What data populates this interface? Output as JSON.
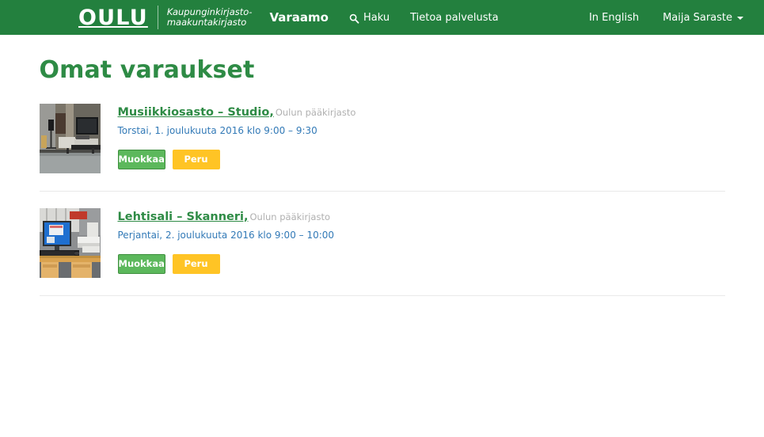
{
  "header": {
    "logo_text": "OULU",
    "logo_subtitle_line1": "Kaupunginkirjasto-",
    "logo_subtitle_line2": "maakuntakirjasto",
    "brand_link": "Varaamo",
    "search_label": "Haku",
    "about_label": "Tietoa palvelusta",
    "language_label": "In English",
    "user_name": "Maija Saraste",
    "background_color": "#23803E"
  },
  "main": {
    "page_title": "Omat varaukset",
    "reservations": [
      {
        "resource": "Musiikkiosasto – Studio,",
        "unit": "Oulun pääkirjasto",
        "time": "Torstai, 1. joulukuuta 2016 klo 9:00 – 9:30",
        "edit_label": "Muokkaa",
        "cancel_label": "Peru",
        "thumbnail_alt": "Musiikkiosasto studio"
      },
      {
        "resource": "Lehtisali – Skanneri,",
        "unit": "Oulun pääkirjasto",
        "time": "Perjantai, 2. joulukuuta 2016 klo 9:00 – 10:00",
        "edit_label": "Muokkaa",
        "cancel_label": "Peru",
        "thumbnail_alt": "Lehtisali skanneri"
      }
    ]
  },
  "colors": {
    "brand_green": "#23803E",
    "title_green": "#2E8B45",
    "link_blue": "#337ab7",
    "button_green": "#5CB85C",
    "button_amber": "#FFC425",
    "muted_gray": "#b0b0b0"
  },
  "icons": {
    "search": "search-icon",
    "caret": "chevron-down-icon"
  }
}
